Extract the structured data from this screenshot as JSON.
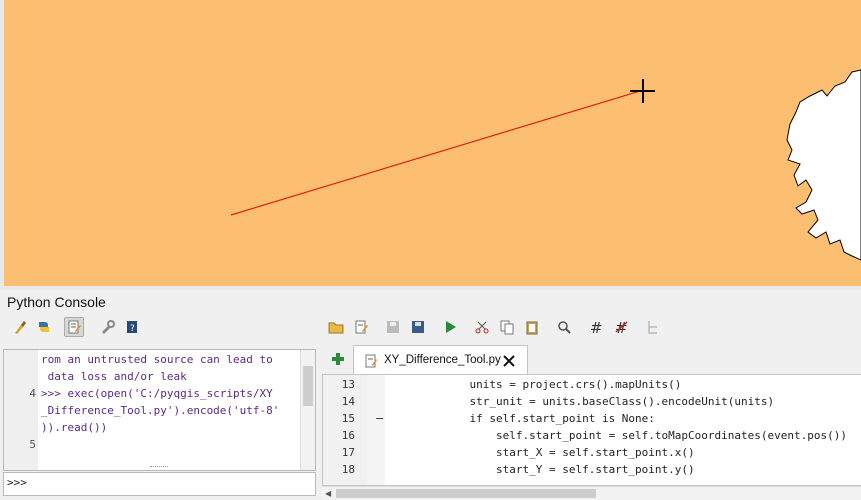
{
  "map": {
    "background_color": "#fcbf72",
    "line_color": "#e02010",
    "landmass_color": "#ffffff",
    "crosshair": "crosshair-cursor"
  },
  "console": {
    "title": "Python Console",
    "left_toolbar": [
      "clear-console-icon",
      "python-run-icon",
      "show-editor-icon",
      "settings-icon",
      "help-icon"
    ],
    "editor_toolbar": [
      "open-file-icon",
      "open-in-editor-icon",
      "save-icon",
      "save-as-icon",
      "run-script-icon",
      "cut-icon",
      "copy-icon",
      "paste-icon",
      "find-icon",
      "comment-icon",
      "uncomment-icon",
      "object-inspector-icon"
    ],
    "output_lines": [
      {
        "num": "",
        "text": "rom an untrusted source can lead to"
      },
      {
        "num": "",
        "text": " data loss and/or leak"
      },
      {
        "num": "4",
        "text": ">>> exec(open('C:/pyqgis_scripts/XY"
      },
      {
        "num": "",
        "text": "_Difference_Tool.py').encode('utf-8'"
      },
      {
        "num": "",
        "text": ")).read())"
      },
      {
        "num": "5",
        "text": ""
      }
    ],
    "input_prompt": ">>>"
  },
  "editor": {
    "tab_label": "XY_Difference_Tool.py",
    "lines": [
      {
        "num": "13",
        "text": "    units = project.crs().mapUnits()"
      },
      {
        "num": "14",
        "text": "    str_unit = units.baseClass().encodeUnit(units)"
      },
      {
        "num": "15",
        "text": "    if self.start_point is None:",
        "fold": "−"
      },
      {
        "num": "16",
        "text": "        self.start_point = self.toMapCoordinates(event.pos())"
      },
      {
        "num": "17",
        "text": "        start_X = self.start_point.x()"
      },
      {
        "num": "18",
        "text": "        start_Y = self.start_point.y()"
      }
    ]
  }
}
